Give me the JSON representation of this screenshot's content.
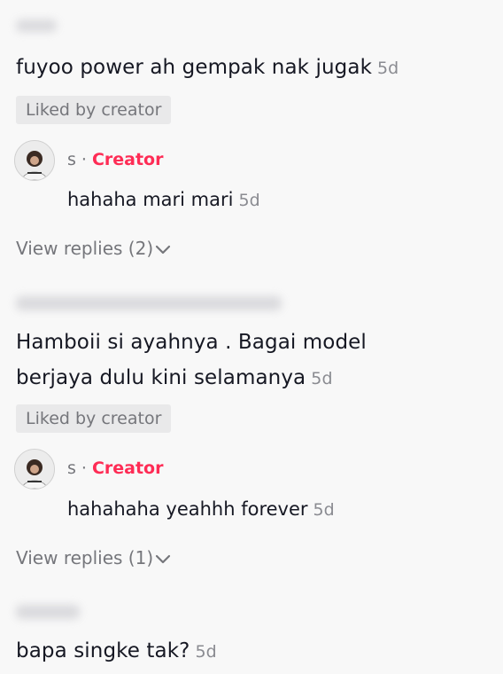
{
  "comments": [
    {
      "text": "fuyoo power ah gempak nak jugak",
      "time": "5d",
      "liked_badge": "Liked by creator",
      "reply": {
        "name": "s",
        "separator": "·",
        "role": "Creator",
        "text": "hahaha mari mari",
        "time": "5d"
      },
      "view_replies": "View replies (2)"
    },
    {
      "text_line1": "Hamboii si ayahnya . Bagai model",
      "text_line2": "berjaya dulu kini selamanya",
      "time": "5d",
      "liked_badge": "Liked by creator",
      "reply": {
        "name": "s",
        "separator": "·",
        "role": "Creator",
        "text": "hahahaha yeahhh forever",
        "time": "5d"
      },
      "view_replies": "View replies (1)"
    },
    {
      "text": "bapa singke tak?",
      "time": "5d"
    }
  ],
  "icons": {
    "chevron": "chevron-down-icon",
    "avatar": "creator-avatar"
  },
  "colors": {
    "accent": "#fe2c55",
    "muted": "#75767b",
    "background": "#f8f8f8"
  }
}
